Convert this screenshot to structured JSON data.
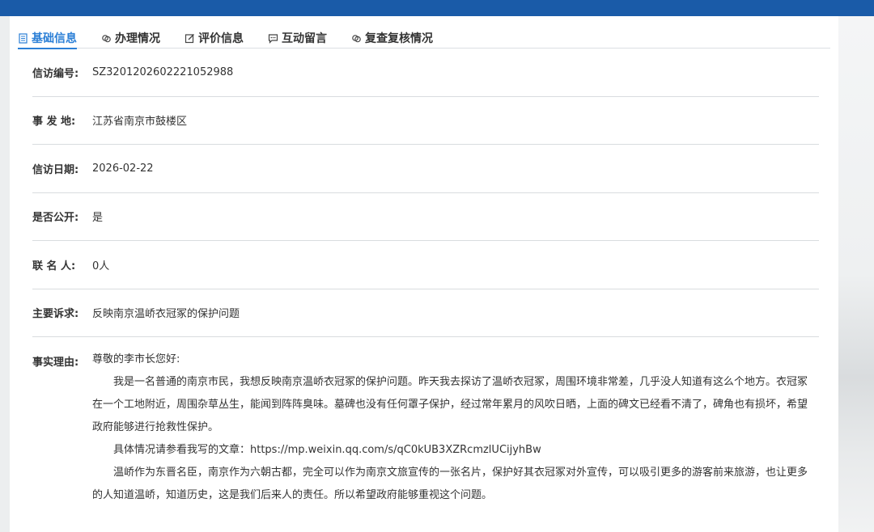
{
  "tabs": [
    {
      "label": "基础信息",
      "icon": "document-icon",
      "active": true
    },
    {
      "label": "办理情况",
      "icon": "link-icon",
      "active": false
    },
    {
      "label": "评价信息",
      "icon": "edit-icon",
      "active": false
    },
    {
      "label": "互动留言",
      "icon": "comment-icon",
      "active": false
    },
    {
      "label": "复查复核情况",
      "icon": "link-icon",
      "active": false
    }
  ],
  "fields": {
    "petition_no": {
      "label": "信访编号:",
      "value": "SZ3201202602221052988"
    },
    "location": {
      "label": "事 发 地:",
      "value": "江苏省南京市鼓楼区"
    },
    "date": {
      "label": "信访日期:",
      "value": "2026-02-22"
    },
    "public": {
      "label": "是否公开:",
      "value": "是"
    },
    "cosigners": {
      "label": "联 名 人:",
      "value": "0人"
    },
    "main_request": {
      "label": "主要诉求:",
      "value": "反映南京温峤衣冠冢的保护问题"
    }
  },
  "reason": {
    "label": "事实理由:",
    "greeting": "尊敬的李市长您好:",
    "para1": "我是一名普通的南京市民，我想反映南京温峤衣冠冢的保护问题。昨天我去探访了温峤衣冠冢，周围环境非常差，几乎没人知道有这么个地方。衣冠冢在一个工地附近，周围杂草丛生，能闻到阵阵臭味。墓碑也没有任何罩子保护，经过常年累月的风吹日晒，上面的碑文已经看不清了，碑角也有损坏，希望政府能够进行抢救性保护。",
    "para2": "具体情况请参看我写的文章：https://mp.weixin.qq.com/s/qC0kUB3XZRcmzlUCijyhBw",
    "para3": "温峤作为东晋名臣，南京作为六朝古都，完全可以作为南京文旅宣传的一张名片，保护好其衣冠冢对外宣传，可以吸引更多的游客前来旅游，也让更多的人知道温峤，知道历史，这是我们后来人的责任。所以希望政府能够重视这个问题。"
  },
  "colors": {
    "topbar": "#1a5ba8",
    "active_tab": "#2b7fd6"
  }
}
